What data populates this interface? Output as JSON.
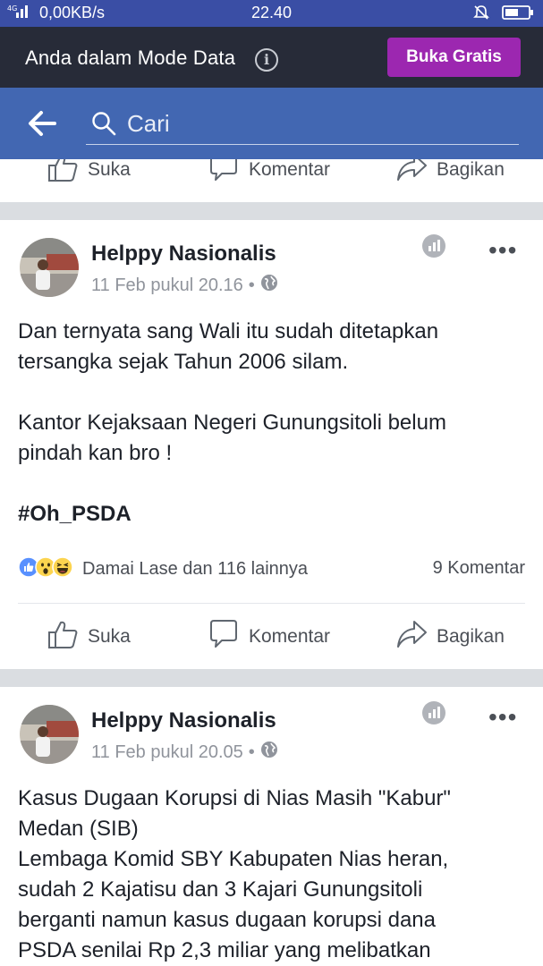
{
  "status_bar": {
    "network": "0,00KB/s",
    "time": "22.40"
  },
  "data_mode_bar": {
    "message": "Anda dalam Mode Data",
    "button_label": "Buka Gratis"
  },
  "search": {
    "placeholder": "Cari"
  },
  "actions": {
    "like": "Suka",
    "comment": "Komentar",
    "share": "Bagikan"
  },
  "posts": [
    {
      "author": "Helppy Nasionalis",
      "timestamp": "11 Feb pukul 20.16",
      "text_lines": [
        "Dan ternyata sang Wali itu sudah ditetapkan",
        "tersangka sejak Tahun 2006 silam.",
        "",
        "Kantor Kejaksaan Negeri Gunungsitoli belum",
        "pindah kan bro !",
        ""
      ],
      "hashtag": "#Oh_PSDA",
      "reaction_names": "Damai Lase dan 116 lainnya",
      "comment_count": "9 Komentar"
    },
    {
      "author": "Helppy Nasionalis",
      "timestamp": "11 Feb pukul 20.05",
      "text_lines": [
        "Kasus Dugaan Korupsi di Nias Masih \"Kabur\"",
        "Medan (SIB)",
        "Lembaga Komid SBY Kabupaten Nias heran,",
        "sudah 2 Kajatisu dan 3 Kajari Gunungsitoli",
        "berganti namun kasus dugaan korupsi dana",
        "PSDA senilai Rp 2,3 miliar yang melibatkan"
      ]
    }
  ],
  "colors": {
    "status_bar": "#3a4ea5",
    "data_bar": "#272b38",
    "buka_gratis": "#9c27b0",
    "facebook_blue": "#4267b2"
  }
}
